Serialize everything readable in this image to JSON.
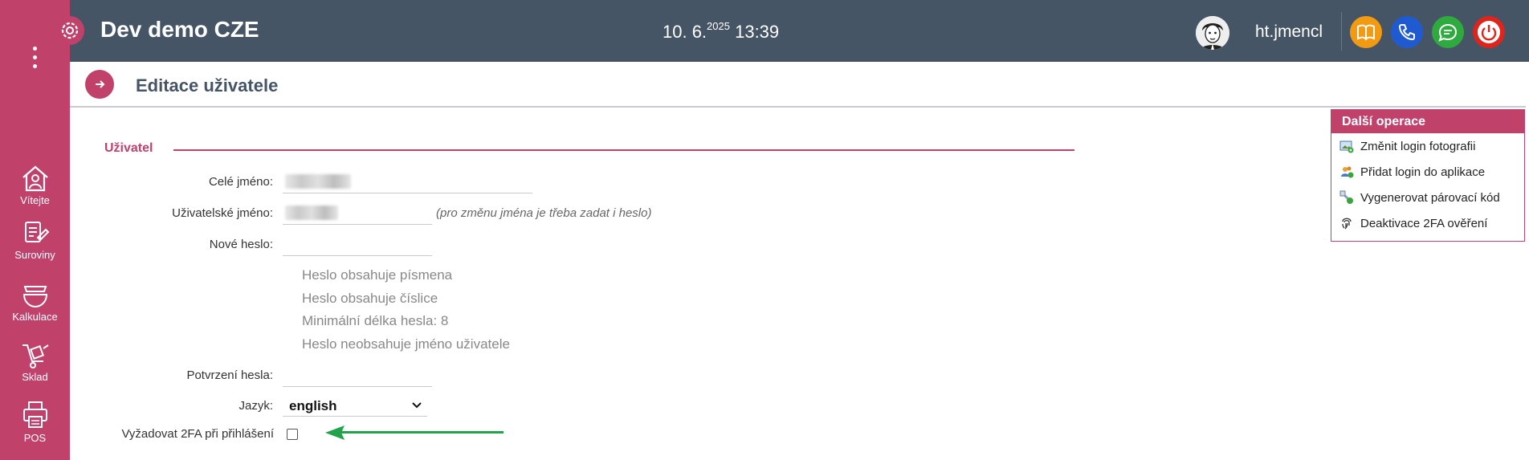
{
  "header": {
    "app_title": "Dev demo CZE",
    "clock_date": "10. 6.",
    "clock_year": "2025",
    "clock_time": "13:39",
    "username": "ht.jmencl",
    "buttons": [
      {
        "name": "manual-button",
        "icon": "book-icon",
        "color": "#f29a12"
      },
      {
        "name": "phone-button",
        "icon": "phone-icon",
        "color": "#1f5ad1"
      },
      {
        "name": "chat-button",
        "icon": "chat-icon",
        "color": "#2eaa3f"
      },
      {
        "name": "logout-button",
        "icon": "power-icon",
        "color": "#e0241b"
      }
    ]
  },
  "sidebar": {
    "items": [
      {
        "label": "Vítejte",
        "icon": "home-icon"
      },
      {
        "label": "Suroviny",
        "icon": "ingredients-icon"
      },
      {
        "label": "Kalkulace",
        "icon": "bowl-icon"
      },
      {
        "label": "Sklad",
        "icon": "cart-icon"
      },
      {
        "label": "POS",
        "icon": "printer-icon"
      }
    ]
  },
  "page": {
    "title": "Editace uživatele",
    "section_title": "Uživatel"
  },
  "form": {
    "full_name_label": "Celé jméno:",
    "username_label": "Uživatelské jméno:",
    "username_hint": "(pro změnu jména je třeba zadat i heslo)",
    "new_password_label": "Nové heslo:",
    "password_rules": [
      "Heslo obsahuje písmena",
      "Heslo obsahuje číslice",
      "Minimální délka hesla: 8",
      "Heslo neobsahuje jméno uživatele"
    ],
    "confirm_password_label": "Potvrzení hesla:",
    "language_label": "Jazyk:",
    "language_value": "english",
    "require_2fa_label": "Vyžadovat 2FA při přihlášení",
    "require_2fa_checked": false
  },
  "ops_panel": {
    "title": "Další operace",
    "items": [
      {
        "label": "Změnit login fotografii",
        "icon": "photo-icon"
      },
      {
        "label": "Přidat login do aplikace",
        "icon": "users-add-icon"
      },
      {
        "label": "Vygenerovat párovací kód",
        "icon": "pairing-code-icon"
      },
      {
        "label": "Deaktivace 2FA ověření",
        "icon": "fingerprint-icon"
      }
    ]
  },
  "colors": {
    "brand": "#c0426b",
    "header_bg": "#465566",
    "arrow": "#22a24a"
  }
}
